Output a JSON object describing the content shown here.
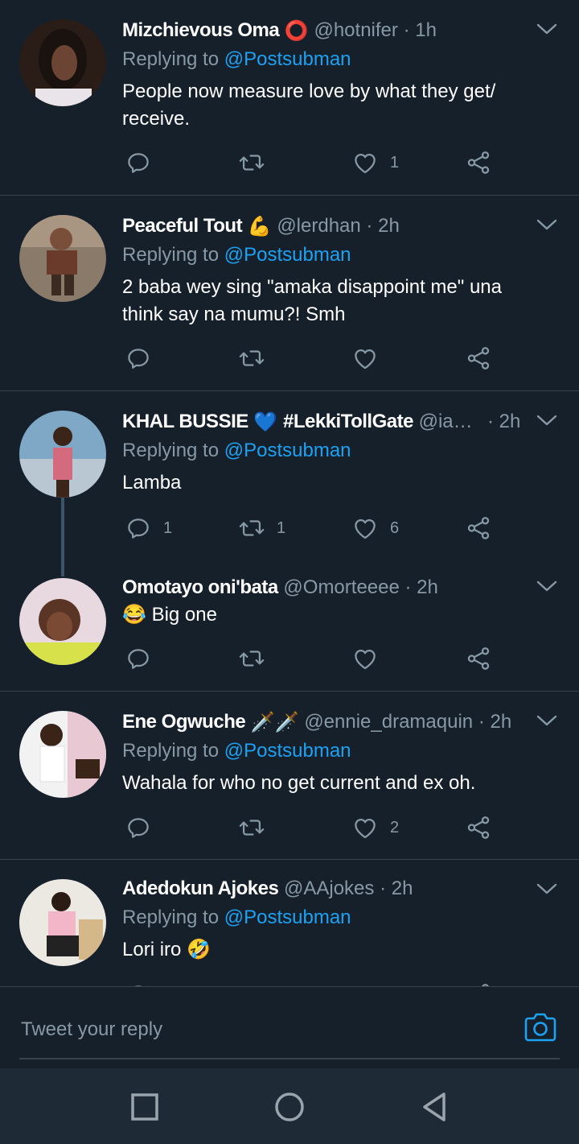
{
  "reply_prefix": "Replying to",
  "tweets": [
    {
      "name": "Mizchievous Oma",
      "emoji": "⭕",
      "handle": "@hotnifer",
      "sep": "·",
      "time": "1h",
      "reply_to": "@Postsubman",
      "text": "People now measure love by what they get/ receive.",
      "counts": {
        "reply": "",
        "retweet": "",
        "like": "1"
      }
    },
    {
      "name": "Peaceful Tout",
      "emoji": "💪",
      "handle": "@lerdhan",
      "sep": "·",
      "time": "2h",
      "reply_to": "@Postsubman",
      "text": "2 baba wey sing \"amaka disappoint me\" una think say na mumu?! Smh",
      "counts": {
        "reply": "",
        "retweet": "",
        "like": ""
      }
    },
    {
      "name": "KHAL BUSSIE",
      "emoji": "💙",
      "name_suffix": "#LekkiTollGate",
      "handle": "@ia…",
      "sep": "·",
      "time": "2h",
      "reply_to": "@Postsubman",
      "text": "Lamba",
      "counts": {
        "reply": "1",
        "retweet": "1",
        "like": "6"
      }
    },
    {
      "name": "Omotayo oni'bata",
      "handle": "@Omorteeee",
      "sep": "·",
      "time": "2h",
      "text_emoji": "😂",
      "text": "Big one",
      "counts": {
        "reply": "",
        "retweet": "",
        "like": ""
      }
    },
    {
      "name": "Ene Ogwuche",
      "emoji": "🗡️🗡️",
      "handle": "@ennie_dramaquin",
      "sep": "·",
      "time": "2h",
      "reply_to": "@Postsubman",
      "text": "Wahala for who no get current and ex oh.",
      "counts": {
        "reply": "",
        "retweet": "",
        "like": "2"
      }
    },
    {
      "name": "Adedokun Ajokes",
      "handle": "@AAjokes",
      "sep": "·",
      "time": "2h",
      "reply_to": "@Postsubman",
      "text": "Lori iro",
      "text_emoji_after": "🤣",
      "counts": {
        "reply": "",
        "retweet": "",
        "like": ""
      }
    }
  ],
  "composer": {
    "placeholder": "Tweet your reply",
    "icon": "camera-icon"
  },
  "navbar": {
    "icons": [
      "recents-square-icon",
      "home-circle-icon",
      "back-triangle-icon"
    ]
  },
  "colors": {
    "background": "#15202b",
    "accent": "#1da1f2",
    "muted": "#8899a6",
    "divider": "#38444d"
  }
}
